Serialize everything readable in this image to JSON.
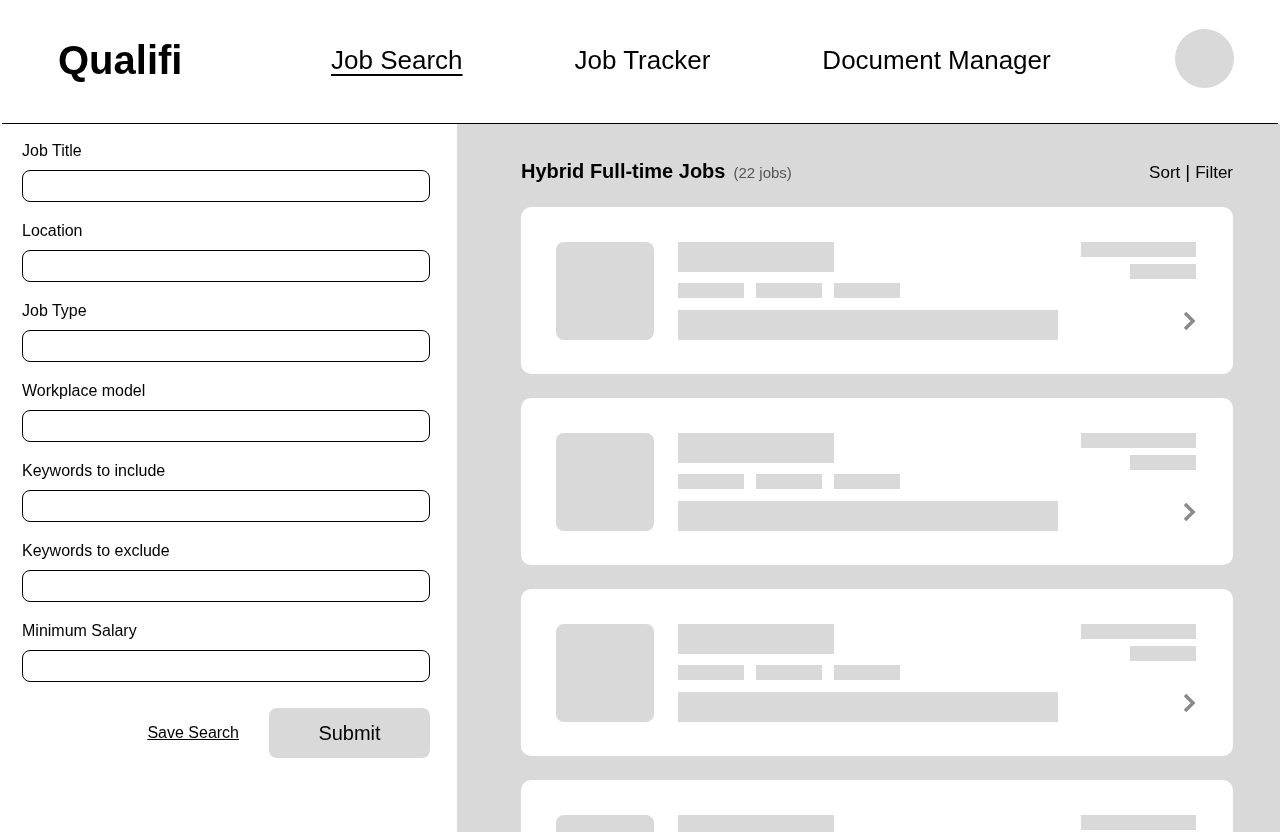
{
  "header": {
    "logo": "Qualifi",
    "nav": [
      {
        "label": "Job Search",
        "selected": true
      },
      {
        "label": "Job Tracker",
        "selected": false
      },
      {
        "label": "Document Manager",
        "selected": false
      }
    ]
  },
  "search_form": {
    "fields": [
      {
        "label": "Job Title"
      },
      {
        "label": "Location"
      },
      {
        "label": "Job Type"
      },
      {
        "label": "Workplace model"
      },
      {
        "label": "Keywords to include"
      },
      {
        "label": "Keywords to exclude"
      },
      {
        "label": "Minimum Salary"
      }
    ],
    "save_link": "Save Search",
    "submit_button": "Submit"
  },
  "results": {
    "title": "Hybrid Full-time Jobs",
    "count": "(22 jobs)",
    "sort": "Sort",
    "separator": "|",
    "filter": "Filter",
    "cards": [
      {
        "kind": "skeleton"
      },
      {
        "kind": "skeleton"
      },
      {
        "kind": "skeleton"
      },
      {
        "kind": "partial"
      }
    ]
  }
}
